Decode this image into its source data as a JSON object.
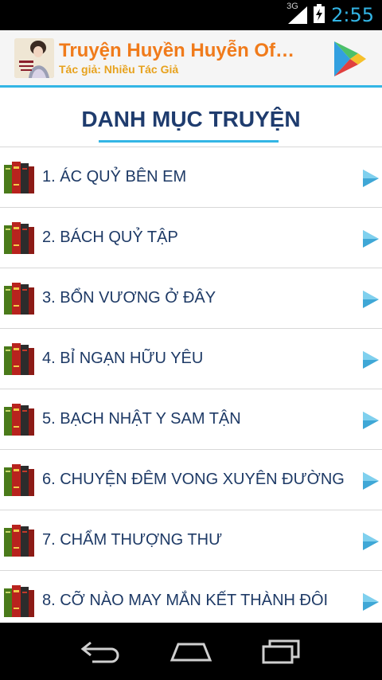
{
  "status_bar": {
    "network": "3G",
    "time": "2:55",
    "accent": "#33b5e5"
  },
  "action_bar": {
    "title": "Truyện Huyền Huyễn Of…",
    "subtitle": "Tác giả: Nhiều Tác Giả",
    "title_color": "#f07b1b",
    "subtitle_color": "#e7a21d"
  },
  "heading": "DANH MỤC TRUYỆN",
  "items": [
    {
      "label": "1. ÁC QUỶ BÊN EM"
    },
    {
      "label": "2. BÁCH QUỶ TẬP"
    },
    {
      "label": "3. BỔN VƯƠNG Ở ĐÂY"
    },
    {
      "label": "4. BỈ NGẠN HỮU YÊU"
    },
    {
      "label": "5. BẠCH NHẬT Y SAM TẬN"
    },
    {
      "label": "6. CHUYỆN ĐÊM VONG XUYÊN ĐƯỜNG"
    },
    {
      "label": "7. CHẨM THƯỢNG THƯ"
    },
    {
      "label": "8. CỠ NÀO MAY MẮN KẾT THÀNH ĐÔI"
    }
  ],
  "icons": {
    "app": "app-cover-icon",
    "store": "google-play-icon",
    "row": "book-stack-icon",
    "arrow": "play-arrow-icon",
    "nav": [
      "back-icon",
      "home-icon",
      "recent-apps-icon"
    ]
  }
}
